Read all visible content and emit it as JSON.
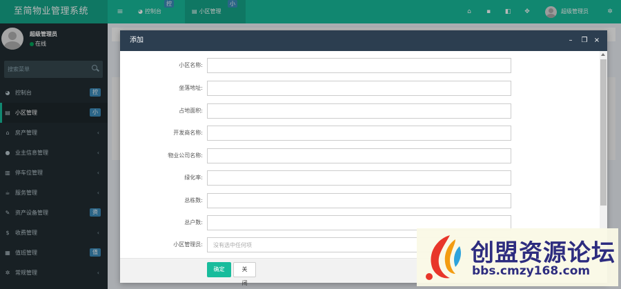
{
  "app": {
    "title": "至简物业管理系统"
  },
  "top_tabs": [
    {
      "label": "控制台",
      "badge": "控"
    },
    {
      "label": "小区管理",
      "badge": "小"
    }
  ],
  "header": {
    "user_name": "超级管理员"
  },
  "sidebar": {
    "profile": {
      "name": "超级管理员",
      "status": "在线"
    },
    "search_placeholder": "搜索菜单",
    "items": [
      {
        "label": "控制台",
        "badge": "控",
        "icon": "dashboard-icon"
      },
      {
        "label": "小区管理",
        "badge": "小",
        "icon": "list-icon"
      },
      {
        "label": "房产管理",
        "arrow": "‹",
        "icon": "home-icon"
      },
      {
        "label": "业主信息管理",
        "arrow": "‹",
        "icon": "user-icon"
      },
      {
        "label": "停车位管理",
        "arrow": "‹",
        "icon": "columns-icon"
      },
      {
        "label": "服务管理",
        "arrow": "‹",
        "icon": "coffee-icon"
      },
      {
        "label": "资产设备管理",
        "badge": "资",
        "icon": "wrench-icon"
      },
      {
        "label": "收费管理",
        "arrow": "‹",
        "icon": "dollar-icon"
      },
      {
        "label": "值班管理",
        "badge": "值",
        "icon": "calendar-icon"
      },
      {
        "label": "常规管理",
        "arrow": "‹",
        "icon": "cogs-icon"
      }
    ]
  },
  "modal": {
    "title": "添加",
    "fields": [
      {
        "label": "小区名称:",
        "value": "",
        "placeholder": ""
      },
      {
        "label": "坐落地址:",
        "value": "",
        "placeholder": ""
      },
      {
        "label": "占地面积:",
        "value": "",
        "placeholder": ""
      },
      {
        "label": "开发商名称:",
        "value": "",
        "placeholder": ""
      },
      {
        "label": "物业公司名称:",
        "value": "",
        "placeholder": ""
      },
      {
        "label": "绿化率:",
        "value": "",
        "placeholder": ""
      },
      {
        "label": "总栋数:",
        "value": "",
        "placeholder": ""
      },
      {
        "label": "总户数:",
        "value": "",
        "placeholder": ""
      },
      {
        "label": "小区管理员:",
        "value": "",
        "placeholder": "没有选中任何项"
      }
    ],
    "ok_label": "确定",
    "close_label": "关闭"
  },
  "watermark": {
    "title": "创盟资源论坛",
    "url": "bbs.cmzy168.com"
  },
  "colors": {
    "brand": "#18bc9c",
    "sidebar": "#222d32",
    "modal_header": "#2c3e50",
    "badge": "#3c8dbc"
  }
}
